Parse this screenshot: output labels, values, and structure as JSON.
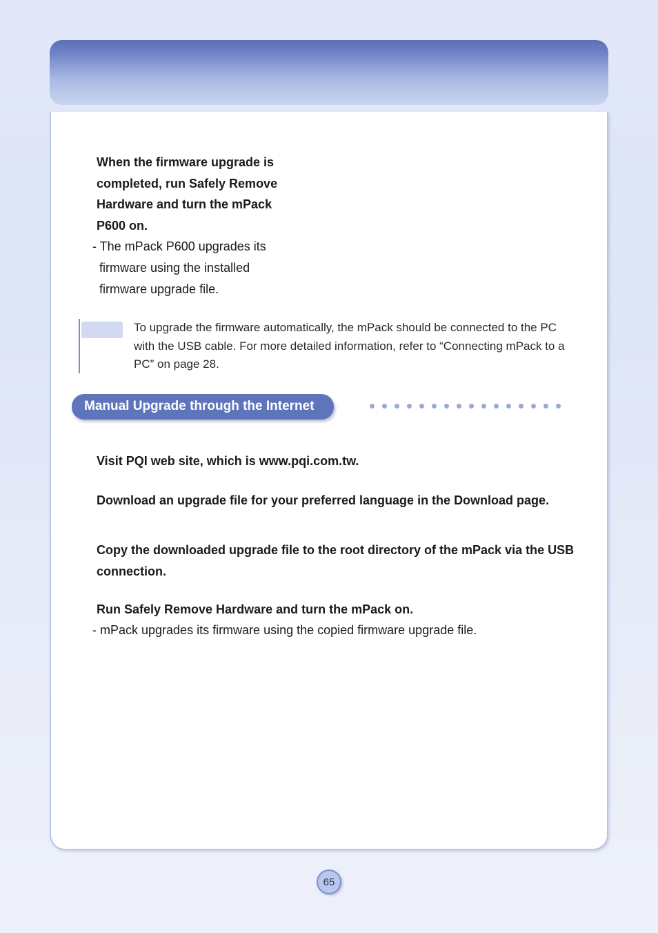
{
  "top_step": {
    "title_lines": [
      "When the firmware upgrade is",
      "completed, run Safely Remove",
      "Hardware and turn the mPack",
      "P600 on."
    ],
    "body_lines": [
      "- The mPack P600 upgrades its",
      "  firmware using the installed",
      "  firmware upgrade file."
    ]
  },
  "note": "To upgrade the firmware automatically, the mPack should be connected to the PC with the USB cable. For more detailed information, refer to “Connecting mPack to a PC” on page 28.",
  "section_heading": "Manual Upgrade through the Internet",
  "steps": [
    {
      "title": "Visit PQI web site, which is www.pqi.com.tw.",
      "body": ""
    },
    {
      "title": "Download an upgrade file for your preferred language in the Download page.",
      "body": ""
    },
    {
      "title": "Copy the downloaded upgrade file to the root directory of the mPack via the USB connection.",
      "body": ""
    },
    {
      "title": "Run Safely Remove Hardware and turn the mPack on.",
      "body": "- mPack upgrades its firmware using the copied firmware upgrade file."
    }
  ],
  "page_number": "65"
}
